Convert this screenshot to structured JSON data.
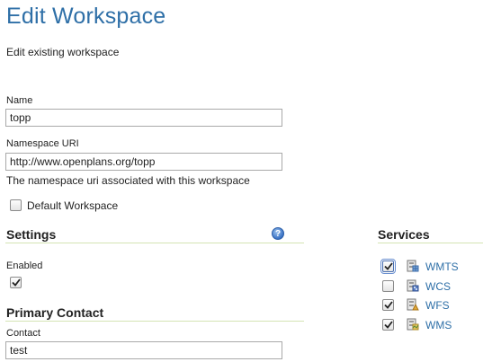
{
  "page": {
    "title": "Edit Workspace",
    "subtitle": "Edit existing workspace"
  },
  "form": {
    "name": {
      "label": "Name",
      "value": "topp"
    },
    "namespace_uri": {
      "label": "Namespace URI",
      "value": "http://www.openplans.org/topp",
      "help": "The namespace uri associated with this workspace"
    },
    "default_workspace": {
      "label": "Default Workspace",
      "checked": false
    }
  },
  "settings": {
    "title": "Settings",
    "enabled_label": "Enabled",
    "enabled": true
  },
  "primary_contact": {
    "title": "Primary Contact",
    "contact_label": "Contact",
    "contact_value": "test"
  },
  "services": {
    "title": "Services",
    "items": [
      {
        "label": "WMTS",
        "checked": true,
        "icon": "wmts-service-icon"
      },
      {
        "label": "WCS",
        "checked": false,
        "icon": "wcs-service-icon"
      },
      {
        "label": "WFS",
        "checked": true,
        "icon": "wfs-service-icon"
      },
      {
        "label": "WMS",
        "checked": true,
        "icon": "wms-service-icon"
      }
    ]
  },
  "colors": {
    "title_blue": "#2e6fa7",
    "section_rule": "#d4e4b4",
    "link_blue": "#2e6fa7"
  }
}
